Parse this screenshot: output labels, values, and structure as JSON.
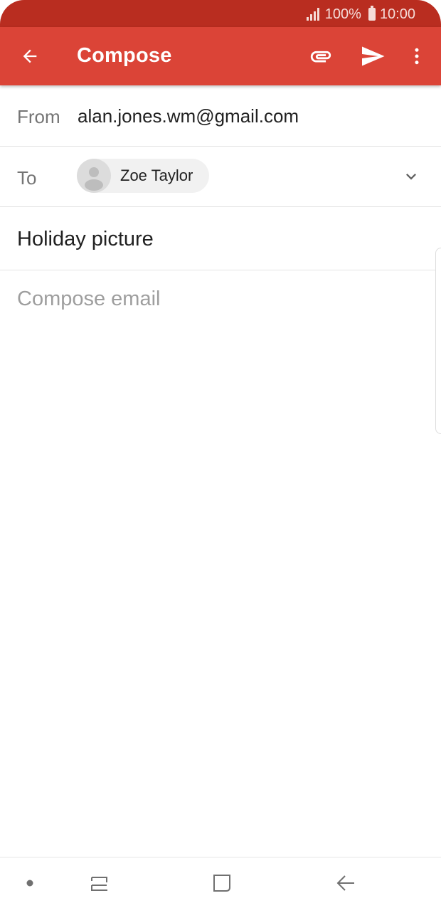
{
  "status_bar": {
    "battery": "100%",
    "time": "10:00",
    "icons": [
      "signal-icon",
      "battery-icon"
    ]
  },
  "app_bar": {
    "title": "Compose",
    "icons": [
      "back-arrow-icon",
      "attachment-icon",
      "send-icon",
      "more-vert-icon"
    ],
    "background": "#db4437",
    "status_background": "#b92d20"
  },
  "compose": {
    "from_label": "From",
    "from_value": "alan.jones.wm@gmail.com",
    "to_label": "To",
    "recipients": [
      {
        "name": "Zoe Taylor",
        "icon": "person-avatar-icon"
      }
    ],
    "subject": "Holiday picture",
    "body_placeholder": "Compose email"
  },
  "nav_bar": {
    "icons": [
      "nav-dot-icon",
      "recents-icon",
      "home-icon",
      "back-icon"
    ]
  }
}
